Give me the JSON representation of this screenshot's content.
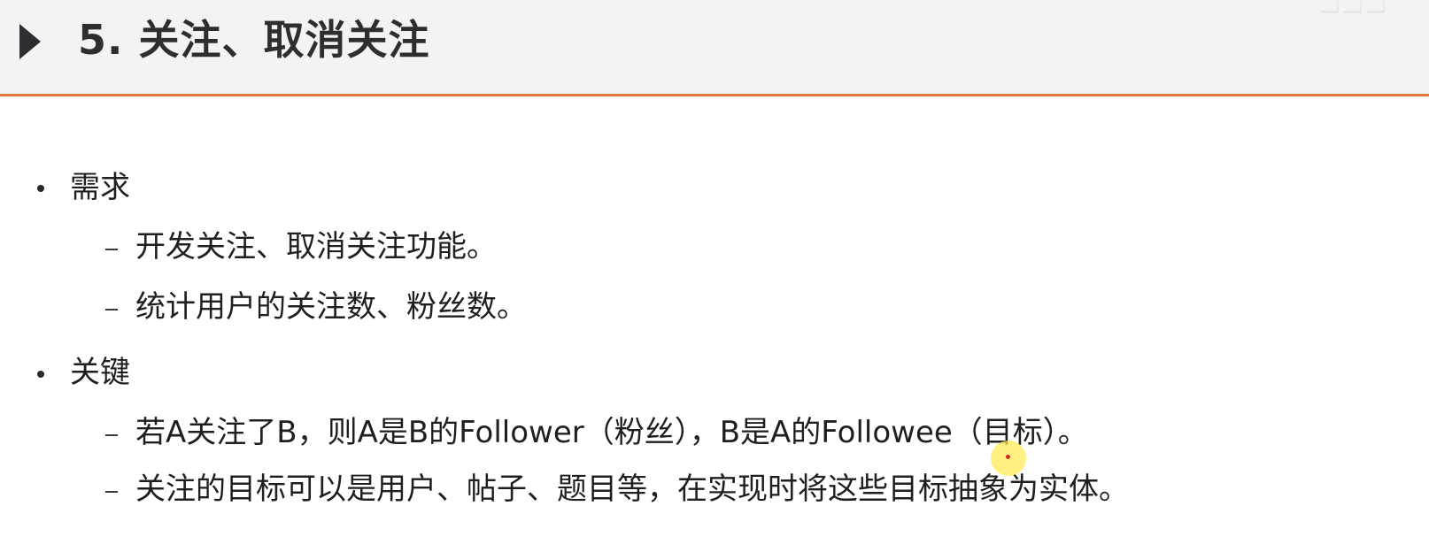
{
  "slide": {
    "title": "5. 关注、取消关注",
    "accent_color": "#e07a3a",
    "title_icon": "triangle-right-icon"
  },
  "sections": [
    {
      "heading": "需求",
      "items": [
        "开发关注、取消关注功能。",
        "统计用户的关注数、粉丝数。"
      ]
    },
    {
      "heading": "关键",
      "items": [
        "若A关注了B，则A是B的Follower（粉丝），B是A的Followee（目标）。",
        "关注的目标可以是用户、帖子、题目等，在实现时将这些目标抽象为实体。"
      ]
    }
  ]
}
